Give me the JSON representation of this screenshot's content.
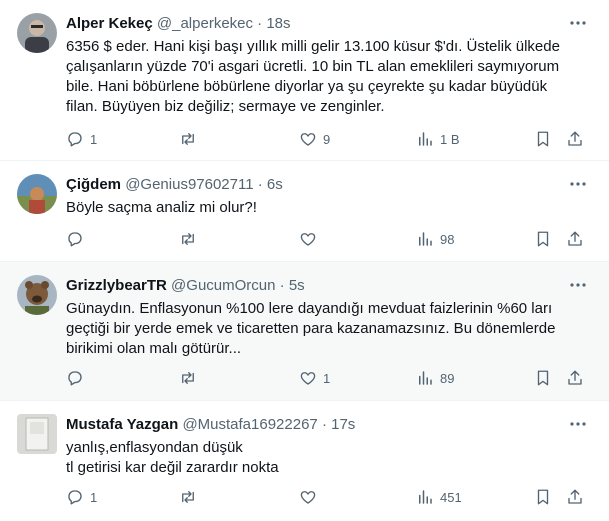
{
  "tweets": [
    {
      "name": "Alper Kekeç",
      "handle": "@_alperkekec",
      "sep": "·",
      "time": "18s",
      "lines": [
        "6356 $ eder. Hani kişi başı yıllık milli gelir 13.100 küsur $'dı. Üstelik ülkede",
        "çalışanların yüzde 70'i asgari ücretli. 10 bin TL alan emeklileri saymıyorum",
        "bile. Hani böbürlene böbürlene diyorlar ya şu çeyrekte şu kadar büyüdük",
        "filan. Büyüyen biz değiliz; sermaye ve zenginler."
      ],
      "replies": "1",
      "retweets": "",
      "likes": "9",
      "views": "1 B"
    },
    {
      "name": "Çiğdem",
      "handle": "@Genius97602711",
      "sep": "·",
      "time": "6s",
      "lines": [
        "Böyle saçma analiz mi olur?!"
      ],
      "replies": "",
      "retweets": "",
      "likes": "",
      "views": "98"
    },
    {
      "name": "GrizzlybearTR",
      "handle": "@GucumOrcun",
      "sep": "·",
      "time": "5s",
      "lines": [
        "Günaydın. Enflasyonun %100 lere dayandığı mevduat faizlerinin %60 ları",
        "geçtiği bir yerde emek ve ticaretten para kazanamazsınız. Bu dönemlerde",
        "birikimi olan malı götürür..."
      ],
      "replies": "",
      "retweets": "",
      "likes": "1",
      "views": "89"
    },
    {
      "name": "Mustafa Yazgan",
      "handle": "@Mustafa16922267",
      "sep": "·",
      "time": "17s",
      "lines": [
        "yanlış,enflasyondan düşük",
        "tl getirisi kar değil zarardır nokta"
      ],
      "replies": "1",
      "retweets": "",
      "likes": "",
      "views": "451"
    }
  ],
  "icons": {
    "more": "more-icon",
    "reply": "reply-icon",
    "retweet": "retweet-icon",
    "like": "like-icon",
    "views": "views-icon",
    "bookmark": "bookmark-icon",
    "share": "share-icon"
  },
  "colors": {
    "text": "#0f1419",
    "secondary": "#536471",
    "highlight_bg": "#f7f9f9",
    "divider": "#eff3f4"
  }
}
